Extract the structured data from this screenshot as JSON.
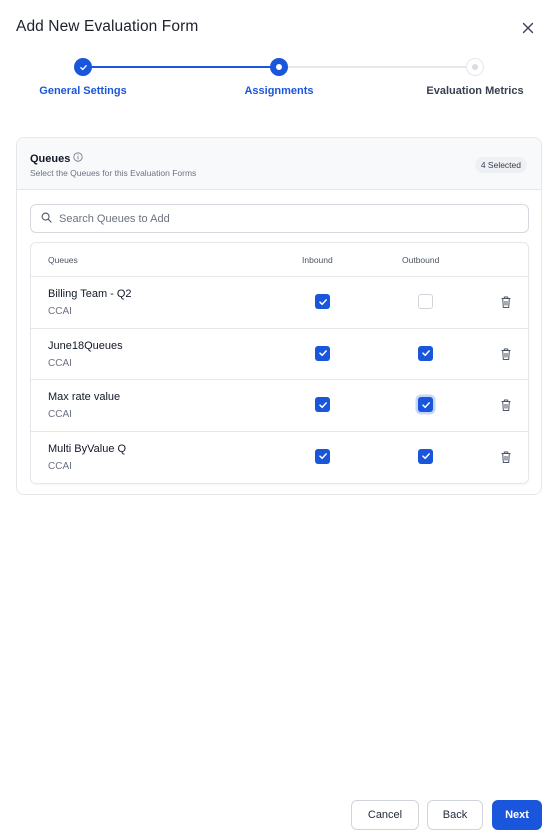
{
  "dialog": {
    "title": "Add New Evaluation Form"
  },
  "stepper": {
    "steps": [
      {
        "label": "General Settings",
        "state": "completed"
      },
      {
        "label": "Assignments",
        "state": "active"
      },
      {
        "label": "Evaluation Metrics",
        "state": "upcoming"
      }
    ]
  },
  "queues": {
    "title": "Queues",
    "subtitle": "Select the Queues for this Evaluation Forms",
    "selected_badge": "4 Selected",
    "search_placeholder": "Search Queues to Add",
    "columns": [
      "Queues",
      "Inbound",
      "Outbound"
    ],
    "rows": [
      {
        "name": "Billing Team - Q2",
        "type": "CCAI",
        "inbound": true,
        "outbound": false
      },
      {
        "name": "June18Queues",
        "type": "CCAI",
        "inbound": true,
        "outbound": true
      },
      {
        "name": "Max rate value",
        "type": "CCAI",
        "inbound": true,
        "outbound": true
      },
      {
        "name": "Multi ByValue Q",
        "type": "CCAI",
        "inbound": true,
        "outbound": true
      }
    ]
  },
  "footer": {
    "cancel_label": "Cancel",
    "back_label": "Back",
    "next_label": "Next"
  },
  "colors": {
    "primary": "#1a56db",
    "border": "#e5e7eb",
    "muted_text": "#6b7280"
  }
}
